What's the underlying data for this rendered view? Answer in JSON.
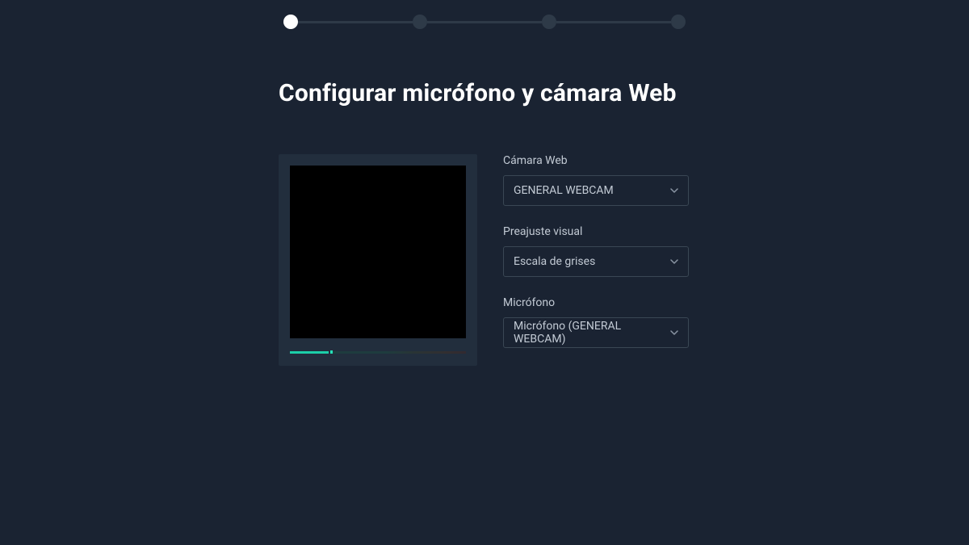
{
  "stepper": {
    "total": 4,
    "current": 1
  },
  "title": "Configurar micrófono y cámara Web",
  "fields": {
    "webcam": {
      "label": "Cámara Web",
      "value": "GENERAL WEBCAM"
    },
    "preset": {
      "label": "Preajuste visual",
      "value": "Escala de grises"
    },
    "microphone": {
      "label": "Micrófono",
      "value": "Micrófono (GENERAL WEBCAM)"
    }
  },
  "meter": {
    "level_percent": 22
  }
}
